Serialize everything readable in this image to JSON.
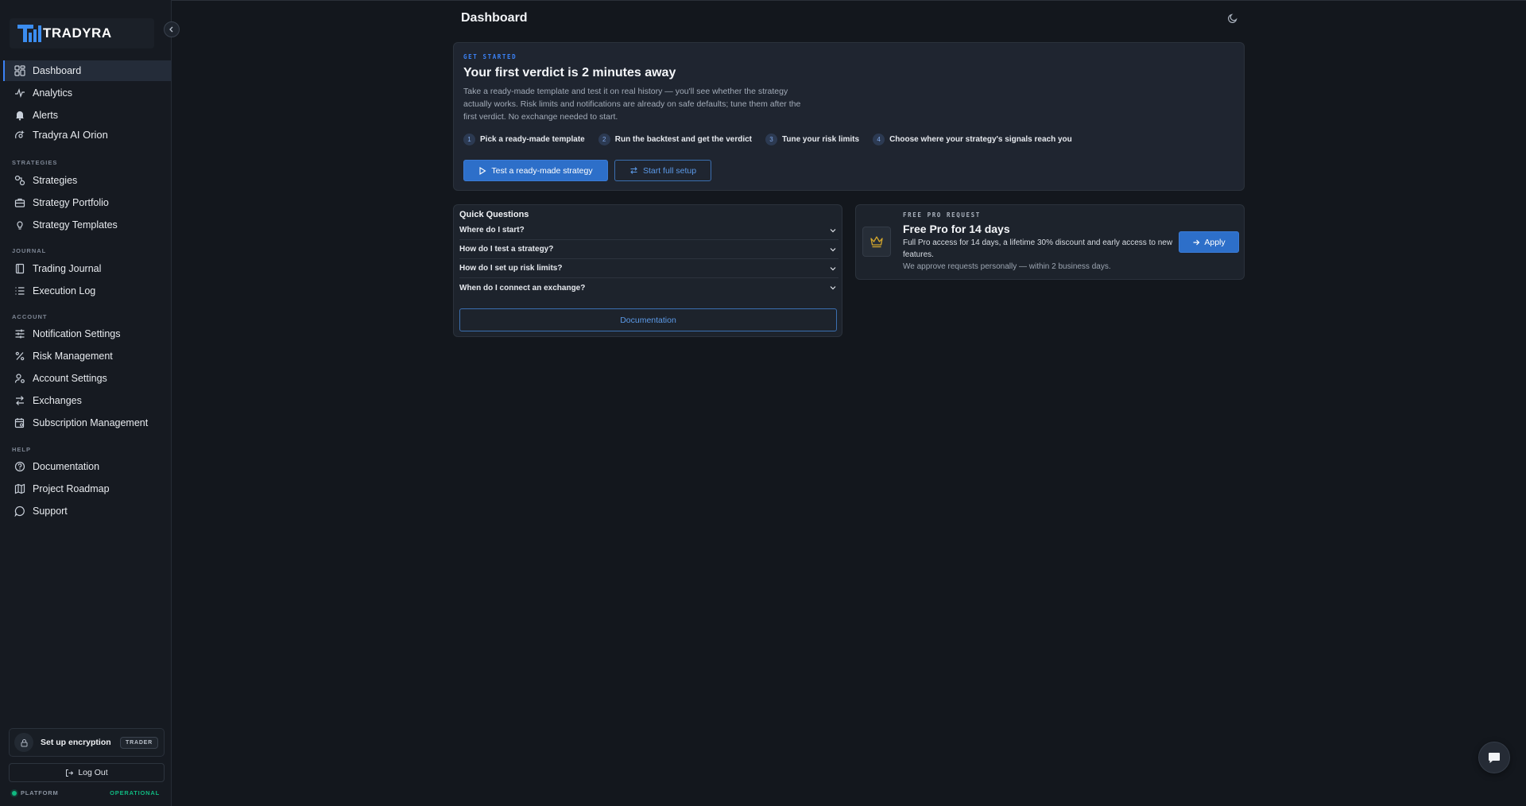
{
  "brand": {
    "name": "TRADYRA"
  },
  "sidebar": {
    "main_items": [
      {
        "label": "Dashboard",
        "icon": "dashboard-icon",
        "active": true
      },
      {
        "label": "Analytics",
        "icon": "activity-icon"
      },
      {
        "label": "Alerts",
        "icon": "bell-icon"
      },
      {
        "label": "Tradyra AI Orion",
        "icon": "ai-icon"
      }
    ],
    "sections": [
      {
        "label": "STRATEGIES",
        "items": [
          {
            "label": "Strategies",
            "icon": "strategies-icon"
          },
          {
            "label": "Strategy Portfolio",
            "icon": "briefcase-icon"
          },
          {
            "label": "Strategy Templates",
            "icon": "lightbulb-icon"
          }
        ]
      },
      {
        "label": "JOURNAL",
        "items": [
          {
            "label": "Trading Journal",
            "icon": "book-icon"
          },
          {
            "label": "Execution Log",
            "icon": "list-icon"
          }
        ]
      },
      {
        "label": "ACCOUNT",
        "items": [
          {
            "label": "Notification Settings",
            "icon": "sliders-icon"
          },
          {
            "label": "Risk Management",
            "icon": "percent-icon"
          },
          {
            "label": "Account Settings",
            "icon": "user-cog-icon"
          },
          {
            "label": "Exchanges",
            "icon": "exchange-icon"
          },
          {
            "label": "Subscription Management",
            "icon": "calendar-cog-icon"
          }
        ]
      },
      {
        "label": "HELP",
        "items": [
          {
            "label": "Documentation",
            "icon": "help-circle-icon"
          },
          {
            "label": "Project Roadmap",
            "icon": "map-icon"
          },
          {
            "label": "Support",
            "icon": "message-circle-icon"
          }
        ]
      }
    ],
    "encryption": {
      "label": "Set up encryption",
      "badge": "TRADER"
    },
    "logout_label": "Log Out",
    "platform": {
      "label": "PLATFORM",
      "status": "OPERATIONAL",
      "status_color": "#10b981"
    }
  },
  "header": {
    "title": "Dashboard"
  },
  "get_started": {
    "eyebrow": "GET STARTED",
    "title": "Your first verdict is 2 minutes away",
    "description": "Take a ready-made template and test it on real history — you'll see whether the strategy actually works. Risk limits and notifications are already on safe defaults; tune them after the first verdict. No exchange needed to start.",
    "steps": [
      {
        "num": "1",
        "label": "Pick a ready-made template"
      },
      {
        "num": "2",
        "label": "Run the backtest and get the verdict"
      },
      {
        "num": "3",
        "label": "Tune your risk limits"
      },
      {
        "num": "4",
        "label": "Choose where your strategy's signals reach you"
      }
    ],
    "primary_button": "Test a ready-made strategy",
    "secondary_button": "Start full setup"
  },
  "quick_questions": {
    "title": "Quick Questions",
    "items": [
      "Where do I start?",
      "How do I test a strategy?",
      "How do I set up risk limits?",
      "When do I connect an exchange?"
    ],
    "documentation_button": "Documentation"
  },
  "pro_request": {
    "eyebrow": "FREE PRO REQUEST",
    "title": "Free Pro for 14 days",
    "description": "Full Pro access for 14 days, a lifetime 30% discount and early access to new features.",
    "note": "We approve requests personally — within 2 business days.",
    "apply_button": "Apply",
    "icon": "crown-icon",
    "icon_color": "#d4a72c"
  },
  "colors": {
    "accent": "#2d6fc9",
    "background": "#13171d",
    "sidebar": "#161a21"
  }
}
